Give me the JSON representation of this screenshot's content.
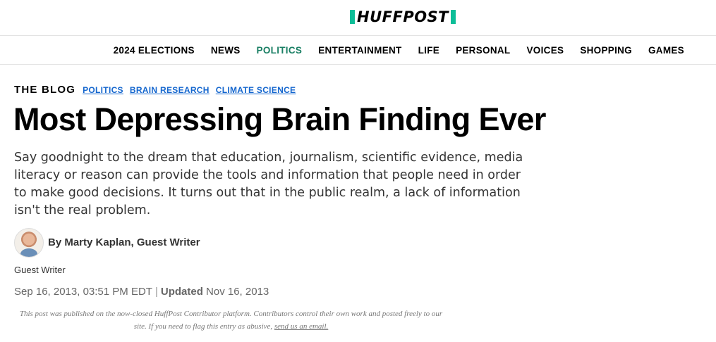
{
  "brand": {
    "logo_text": "HUFFPOST",
    "accent": "#0dbe98"
  },
  "nav": {
    "items": [
      {
        "label": "2024 ELECTIONS",
        "active": false
      },
      {
        "label": "NEWS",
        "active": false
      },
      {
        "label": "POLITICS",
        "active": true
      },
      {
        "label": "ENTERTAINMENT",
        "active": false
      },
      {
        "label": "LIFE",
        "active": false
      },
      {
        "label": "PERSONAL",
        "active": false
      },
      {
        "label": "VOICES",
        "active": false
      },
      {
        "label": "SHOPPING",
        "active": false
      },
      {
        "label": "GAMES",
        "active": false
      }
    ],
    "active_color": "#1a7f64"
  },
  "article": {
    "section_label": "THE BLOG",
    "tags": [
      "POLITICS",
      "BRAIN RESEARCH",
      "CLIMATE SCIENCE"
    ],
    "tag_color": "#1466ce",
    "headline": "Most Depressing Brain Finding Ever",
    "dek": "Say goodnight to the dream that education, journalism, scientific evidence, media literacy or reason can provide the tools and information that people need in order to make good decisions. It turns out that in the public realm, a lack of information isn't the real problem.",
    "byline": "By Marty Kaplan, Guest Writer",
    "author_role": "Guest Writer",
    "published": "Sep 16, 2013, 03:51 PM EDT",
    "updated_label": "Updated",
    "updated": "Nov 16, 2013",
    "disclaimer_text": "This post was published on the now-closed HuffPost Contributor platform. Contributors control their own work and posted freely to our site. If you need to flag this entry as abusive,",
    "disclaimer_link": "send us an email."
  }
}
